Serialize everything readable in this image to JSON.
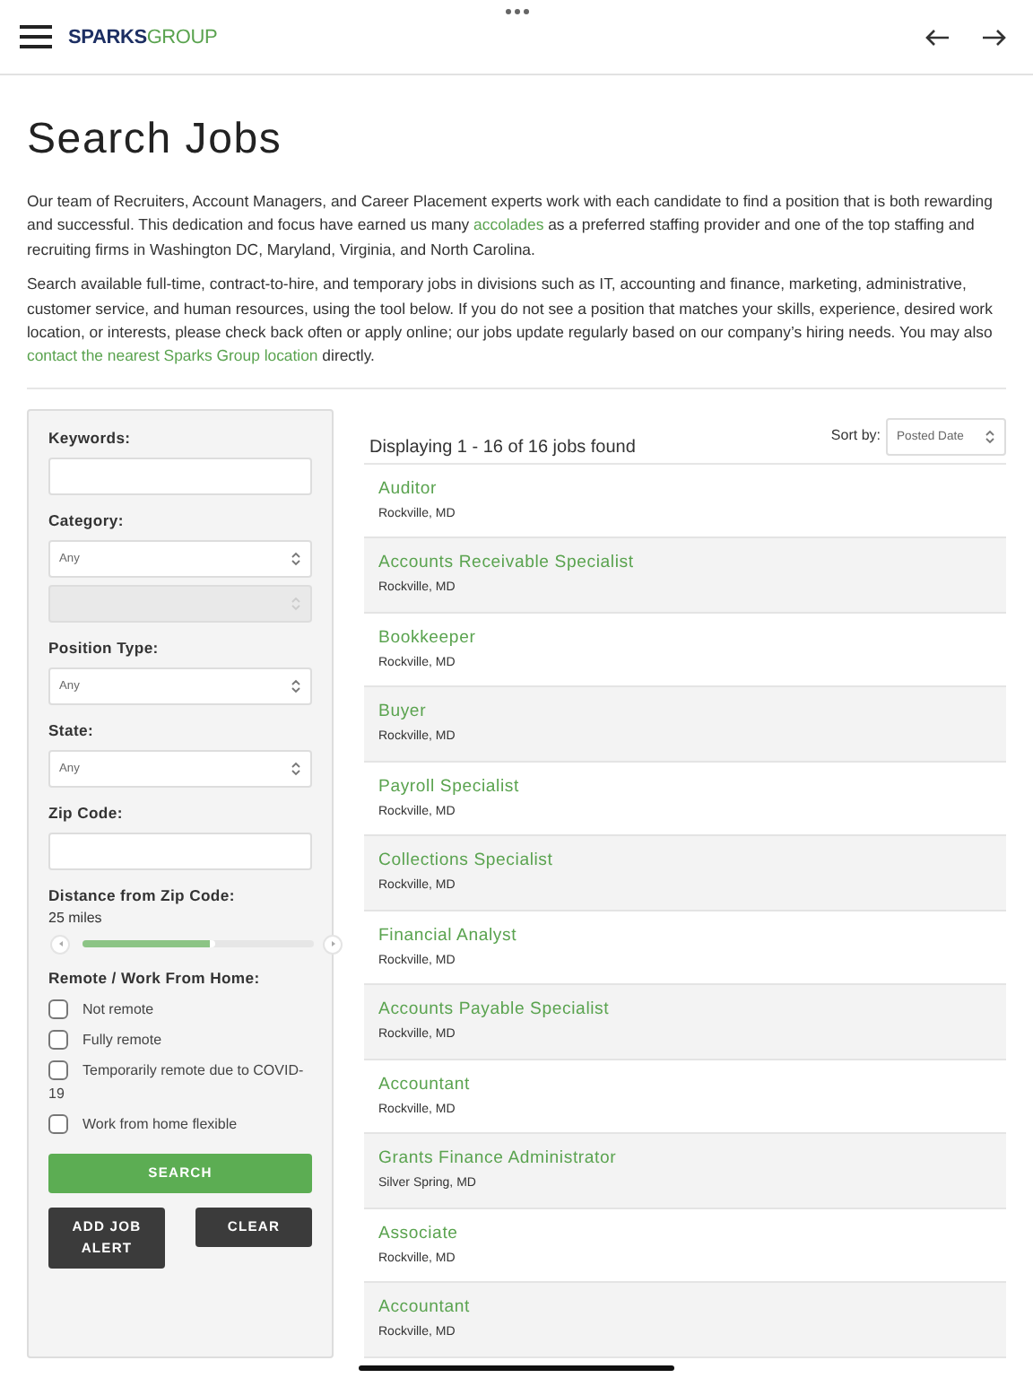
{
  "header": {
    "logo": {
      "first": "SPARKS",
      "second": "GROUP"
    }
  },
  "title": "Search Jobs",
  "paragraphs": [
    [
      {
        "kind": "text",
        "text": "Our team of Recruiters, Account Managers, and Career Placement experts work with each candidate to find a position that is both rewarding and successful. This dedication and focus have earned us many "
      },
      {
        "kind": "link",
        "text": "accolades"
      },
      {
        "kind": "text",
        "text": " as a preferred staffing provider and one of the top staffing and recruiting firms in Washington DC, Maryland, Virginia, and North Carolina."
      }
    ],
    [
      {
        "kind": "text",
        "text": "Search available full-time, contract-to-hire, and temporary jobs in divisions such as IT, accounting and finance, marketing, administrative, customer service, and human resources, using the tool below. If you do not see a position that matches your skills, experience, desired work location, or interests, please check back often or apply online; our jobs update regularly based on our company’s hiring needs. You may also "
      },
      {
        "kind": "link",
        "text": "contact the nearest Sparks Group location"
      },
      {
        "kind": "text",
        "text": " directly."
      }
    ]
  ],
  "filters": [
    {
      "kind": "text",
      "label": "Keywords:"
    },
    {
      "kind": "select",
      "label": "Category:",
      "value": "Any",
      "disabled": false
    },
    {
      "kind": "select",
      "disabled": true
    },
    {
      "kind": "select",
      "label": "Position Type:",
      "value": "Any",
      "disabled": false
    },
    {
      "kind": "select",
      "label": "State:",
      "value": "Any",
      "disabled": false
    },
    {
      "kind": "text",
      "label": "Zip Code:"
    },
    {
      "kind": "slider",
      "label": "Distance from Zip Code:",
      "reading": "25 miles",
      "level": 0.57
    },
    {
      "kind": "checkboxes",
      "label": "Remote / Work From Home:",
      "options": [
        {
          "label": "Not remote",
          "checked": false
        },
        {
          "label": "Fully remote",
          "checked": false
        },
        {
          "label": "Temporarily remote due to COVID-19",
          "checked": false
        },
        {
          "label": "Work from home flexible",
          "checked": false
        }
      ]
    }
  ],
  "buttons": {
    "search": "SEARCH",
    "alert": "ADD JOB ALERT",
    "clear": "CLEAR"
  },
  "results": {
    "summary": "Displaying 1 - 16 of 16 jobs found",
    "sort_label": "Sort by:",
    "sort_value": "Posted Date",
    "jobs": [
      {
        "title": "Auditor",
        "location": "Rockville, MD"
      },
      {
        "title": "Accounts Receivable Specialist",
        "location": "Rockville, MD"
      },
      {
        "title": "Bookkeeper",
        "location": "Rockville, MD"
      },
      {
        "title": "Buyer",
        "location": "Rockville, MD"
      },
      {
        "title": "Payroll Specialist",
        "location": "Rockville, MD"
      },
      {
        "title": "Collections Specialist",
        "location": "Rockville, MD"
      },
      {
        "title": "Financial Analyst",
        "location": "Rockville, MD"
      },
      {
        "title": "Accounts Payable Specialist",
        "location": "Rockville, MD"
      },
      {
        "title": "Accountant",
        "location": "Rockville, MD"
      },
      {
        "title": "Grants Finance Administrator",
        "location": "Silver Spring, MD"
      },
      {
        "title": "Associate",
        "location": "Rockville, MD"
      },
      {
        "title": "Accountant",
        "location": "Rockville, MD"
      }
    ]
  }
}
